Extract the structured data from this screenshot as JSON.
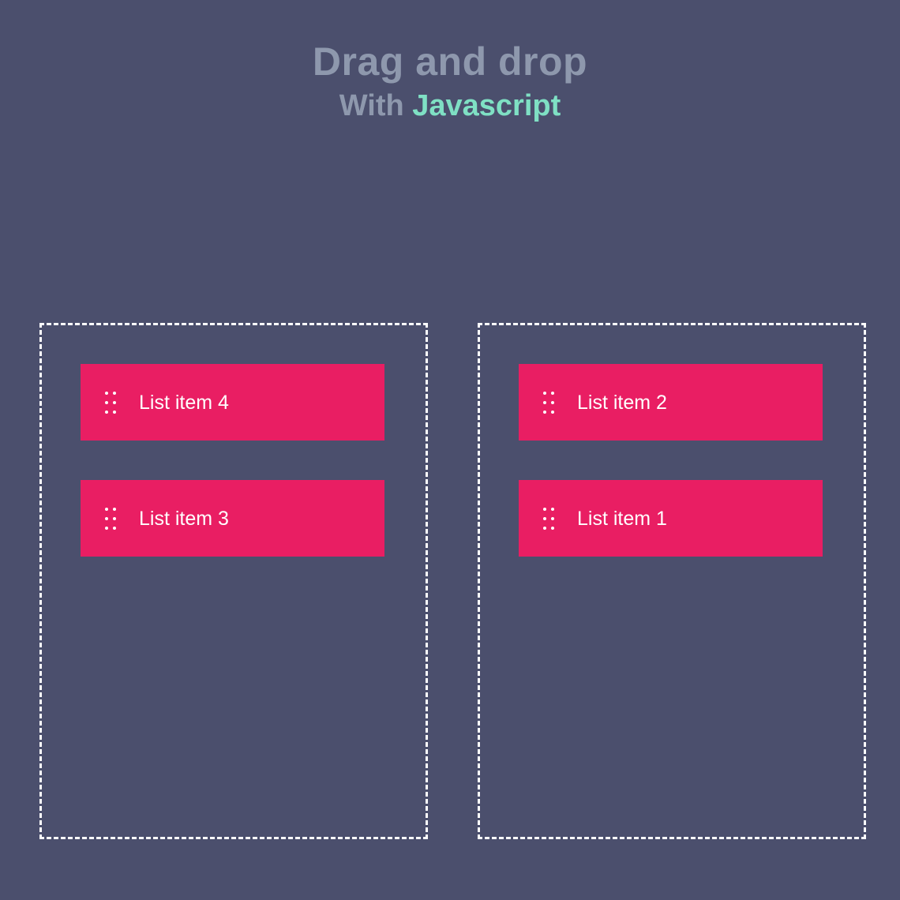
{
  "header": {
    "title": "Drag and drop",
    "subtitle_prefix": "With ",
    "subtitle_accent": "Javascript"
  },
  "colors": {
    "background": "#4b4f6d",
    "title": "#8e98ad",
    "accent": "#7fe0c4",
    "item": "#e91e63",
    "dropzone_border": "#ffffff"
  },
  "columns": [
    {
      "items": [
        {
          "label": "List item 4",
          "icon": "drag-handle-icon"
        },
        {
          "label": "List item 3",
          "icon": "drag-handle-icon"
        }
      ]
    },
    {
      "items": [
        {
          "label": "List item 2",
          "icon": "drag-handle-icon"
        },
        {
          "label": "List item 1",
          "icon": "drag-handle-icon"
        }
      ]
    }
  ]
}
